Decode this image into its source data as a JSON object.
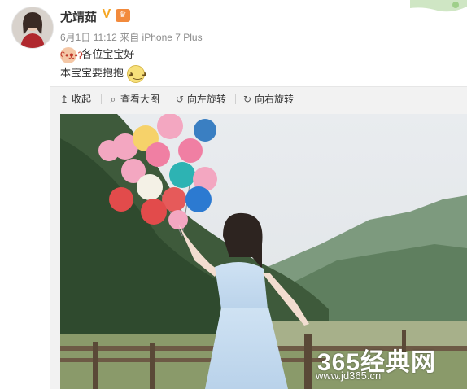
{
  "user": {
    "name": "尤靖茹",
    "verified_badge": "V",
    "vip_badge": "icon-vip"
  },
  "meta": {
    "date": "6月1日",
    "time": "11:12",
    "via": "来自",
    "device": "iPhone 7 Plus"
  },
  "post": {
    "line1": "-各位宝宝好",
    "line2": "本宝宝要抱抱",
    "emoji1": "bear-emoji",
    "emoji2": "cat-emoji"
  },
  "toolbar": {
    "collapse": "收起",
    "view_large": "查看大图",
    "rotate_left": "向左旋转",
    "rotate_right": "向右旋转",
    "icons": [
      "collapse-icon",
      "magnifier-icon",
      "rotate-left-icon",
      "rotate-right-icon"
    ]
  },
  "watermark": {
    "title": "365经典网",
    "url": "www.jd365.cn"
  },
  "colors": {
    "toolbar_bg": "#f2f2f2",
    "verified": "#f5a623",
    "meta_text": "#8a8a8a"
  }
}
